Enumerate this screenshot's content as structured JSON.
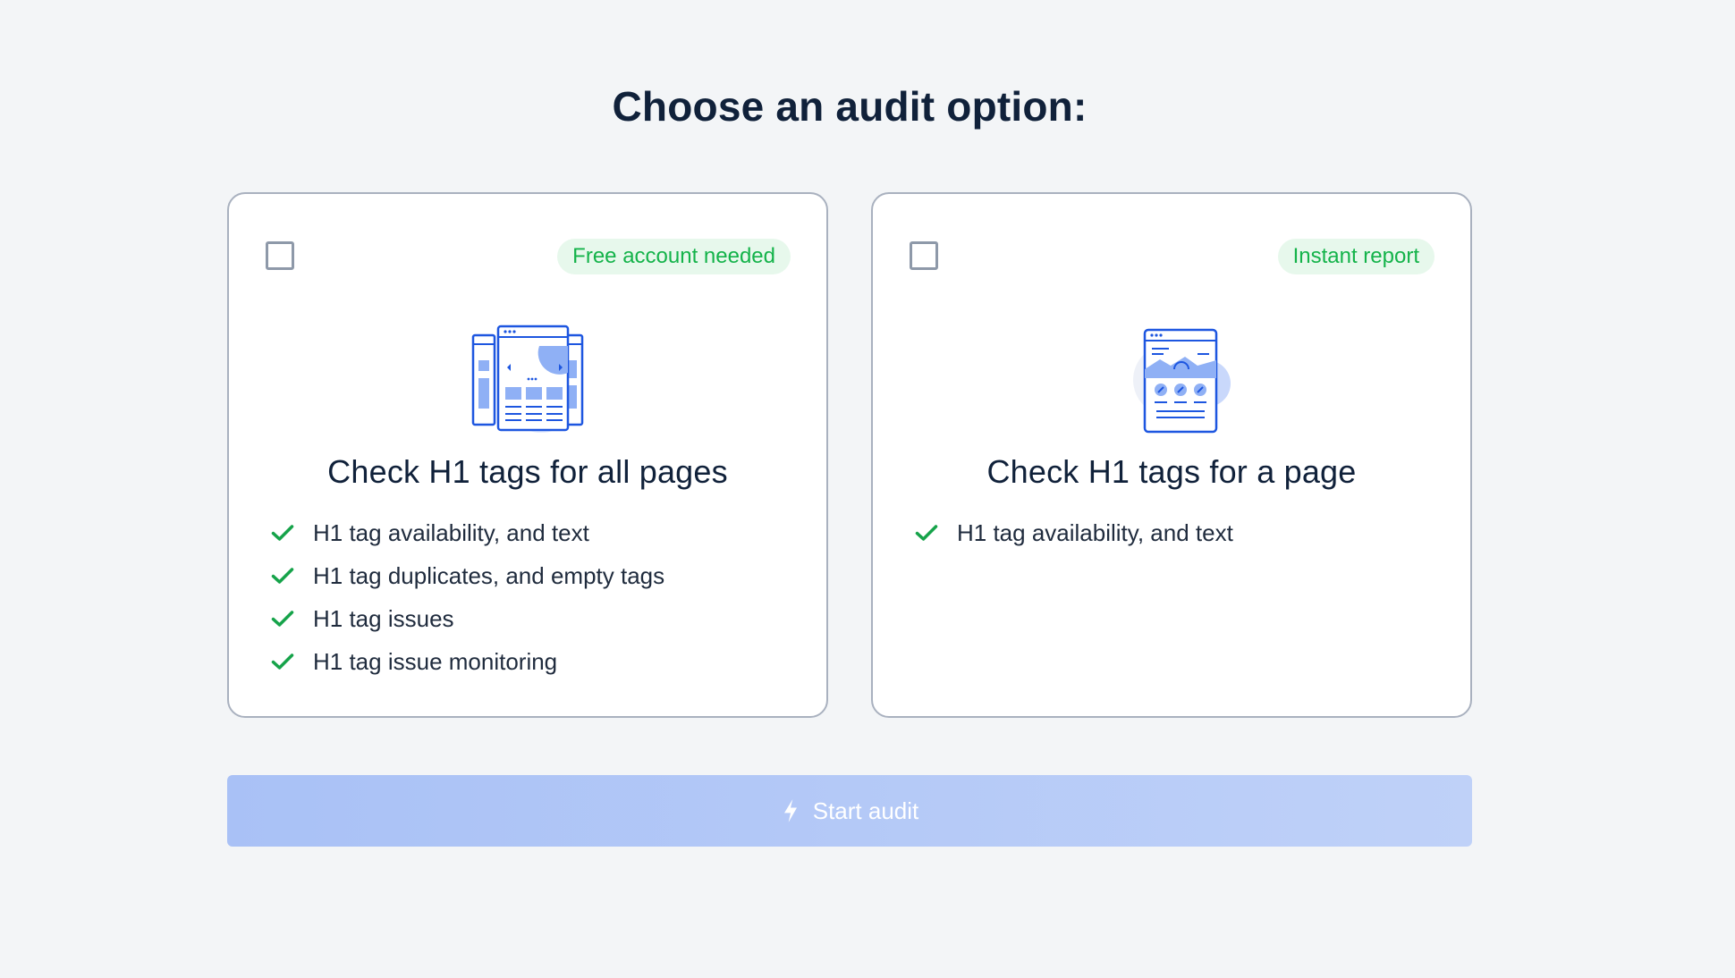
{
  "heading": "Choose an audit option:",
  "cards": [
    {
      "badge": "Free account needed",
      "title": "Check H1 tags for all pages",
      "features": [
        "H1 tag availability, and text",
        "H1 tag duplicates, and empty tags",
        "H1 tag issues",
        "H1 tag issue monitoring"
      ],
      "checked": false,
      "illustration": "multi-page-illustration"
    },
    {
      "badge": "Instant report",
      "title": "Check H1 tags for a page",
      "features": [
        "H1 tag availability, and text"
      ],
      "checked": false,
      "illustration": "single-page-illustration"
    }
  ],
  "start_button": {
    "label": "Start audit",
    "icon": "lightning-icon",
    "disabled": true
  },
  "colors": {
    "accent": "#2563eb",
    "badge_text": "#14b34a",
    "badge_bg": "#e7f8ec",
    "check": "#16a34a",
    "button_bg": "#b3c8f7"
  }
}
